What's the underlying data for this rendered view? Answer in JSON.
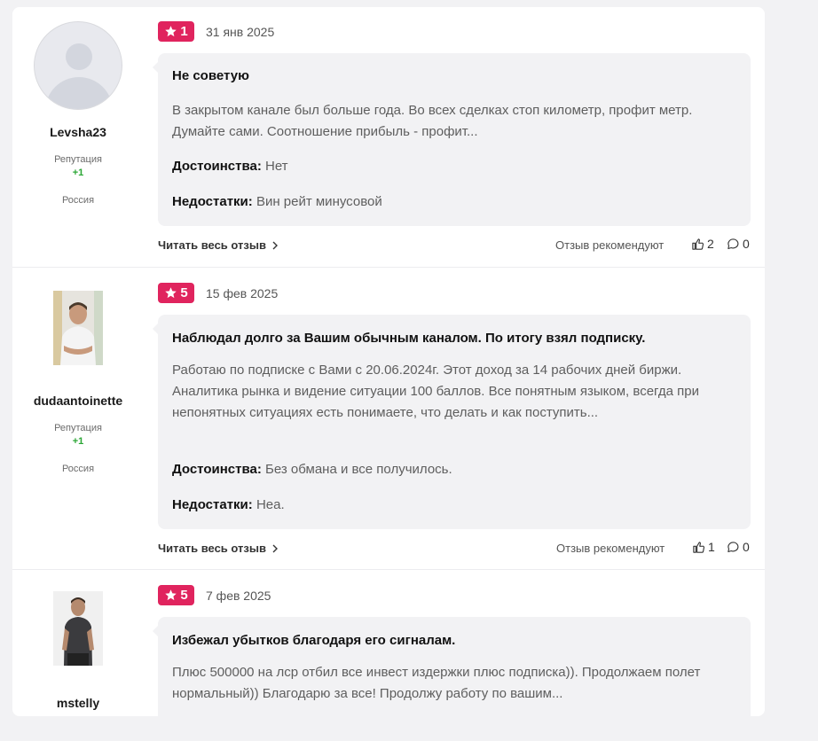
{
  "reviews": [
    {
      "username": "Levsha23",
      "reputation_label": "Репутация",
      "reputation_value": "+1",
      "country": "Россия",
      "rating": "1",
      "date": "31 янв 2025",
      "title": "Не советую",
      "text": "В закрытом канале был больше года. Во всех сделках стоп километр, профит метр. Думайте сами. Соотношение прибыль - профит...",
      "pros_label": "Достоинства:",
      "pros": "Нет",
      "cons_label": "Недостатки:",
      "cons": "Вин рейт минусовой",
      "read_more": "Читать весь отзыв",
      "recommend_label": "Отзыв рекомендуют",
      "likes": "2",
      "comments": "0"
    },
    {
      "username": "dudaantoinette",
      "reputation_label": "Репутация",
      "reputation_value": "+1",
      "country": "Россия",
      "rating": "5",
      "date": "15 фев 2025",
      "title": "Наблюдал долго за Вашим обычным каналом. По итогу взял подписку.",
      "text": "Работаю по подписке с Вами с 20.06.2024г. Этот доход за 14 рабочих дней биржи. Аналитика рынка и видение ситуации 100 баллов. Все понятным языком, всегда при непонятных ситуациях есть понимаете, что делать и как поступить...",
      "pros_label": "Достоинства:",
      "pros": "Без обмана и все получилось.",
      "cons_label": "Недостатки:",
      "cons": "Неа.",
      "read_more": "Читать весь отзыв",
      "recommend_label": "Отзыв рекомендуют",
      "likes": "1",
      "comments": "0"
    },
    {
      "username": "mstelly",
      "rating": "5",
      "date": "7 фев 2025",
      "title": "Избежал убытков благодаря его сигналам.",
      "text": "Плюс 500000 на лср отбил все инвест издержки плюс подписка)). Продолжаем полет нормальный)) Благодарю за все! Продолжу работу по вашим..."
    }
  ],
  "colors": {
    "badge": "#e0245e",
    "reputation": "#2aa634",
    "bubble": "#f2f2f4"
  }
}
